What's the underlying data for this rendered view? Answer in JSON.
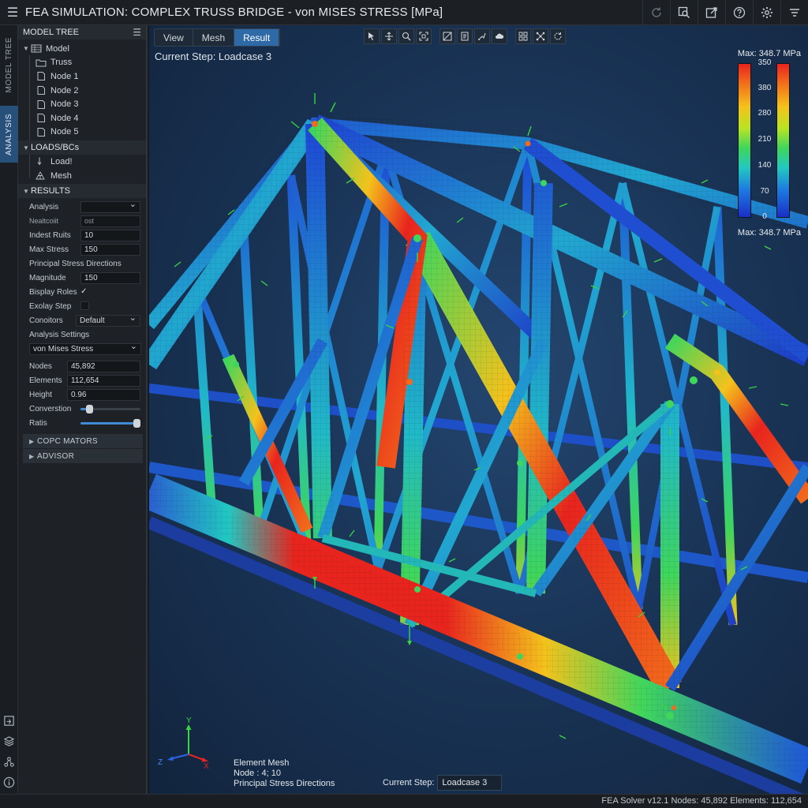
{
  "window": {
    "title": "FEA SIMULATION: COMPLEX TRUSS BRIDGE - von MISES STRESS [MPa]"
  },
  "rail": {
    "tabs": [
      "MODEL TREE",
      "ANALYSIS"
    ]
  },
  "panel": {
    "model_tree_header": "MODEL TREE",
    "tree": {
      "root": "Model",
      "children": [
        "Truss",
        "Node 1",
        "Node 2",
        "Node 3",
        "Node 4",
        "Node 5"
      ]
    },
    "loads_header": "LOADS/BCs",
    "loads": [
      "Load!",
      "Mesh"
    ],
    "results_header": "RESULTS",
    "props": {
      "analysis_label": "Analysis",
      "analysis_value": "",
      "result_label": "Nealtcoiit",
      "result_value": "ost",
      "indest_label": "Indest Ruits",
      "indest_value": "10",
      "max_stress_label": "Max Stress",
      "max_stress_value": "150",
      "principal_label": "Principal Stress Directions",
      "magnitude_label": "Magnitude",
      "magnitude_value": "150",
      "display_roles_label": "Bisplay Roles",
      "display_roles_check": "✓",
      "display_step_label": "Exolay Step",
      "conditions_label": "Conoitors",
      "conditions_value": "Default",
      "analysis_settings_label": "Analysis Settings",
      "stress_type_value": "von Mises Stress",
      "nodes_label": "Nodes",
      "nodes_value": "45,892",
      "elements_label": "Elements",
      "elements_value": "112,654",
      "height_label": "Height",
      "height_value": "0.96",
      "conversion_label": "Converstion",
      "conversion_level": 0.15,
      "ratis_label": "Ratis",
      "ratis_level": 0.95
    },
    "sections": [
      "COPC MATORS",
      "ADVISOR"
    ]
  },
  "viewport": {
    "tabs": [
      "View",
      "Mesh",
      "Result"
    ],
    "active_tab": "Result",
    "step_label": "Current Step: Loadcase 3",
    "legend": {
      "max_label_top": "Max: 348.7 MPa",
      "max_label_bottom": "Max: 348.7 MPa",
      "ticks": [
        "350",
        "380",
        "280",
        "210",
        "140",
        "70",
        "0"
      ]
    },
    "axes": {
      "x": "X",
      "y": "Y",
      "z": "Z"
    },
    "info_lines": [
      "Element Mesh",
      "Node : 4; 10",
      "Principal Stress Directions"
    ],
    "current_step_label": "Current Step:",
    "current_step_value": "Loadcase 3"
  },
  "status": {
    "text": "FEA Solver v12.1   Nodes: 45,892   Elements: 112,654"
  },
  "colors": {
    "accent": "#2f6aa8",
    "stress_high": "#e8241e",
    "stress_mid": "#3fd65c",
    "stress_low": "#1a2fc8"
  }
}
